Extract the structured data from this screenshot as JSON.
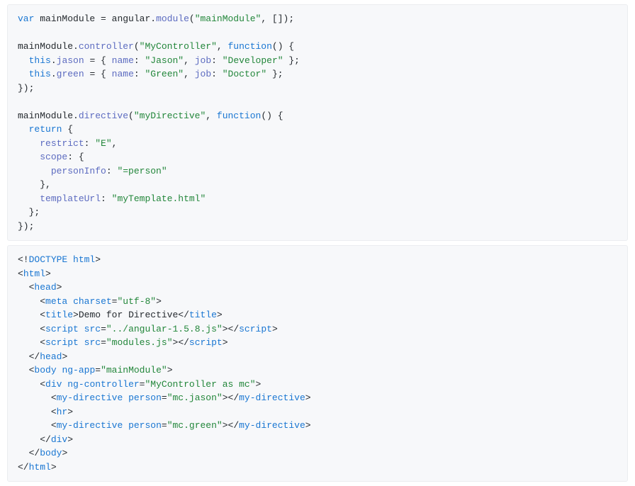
{
  "js": {
    "l1": {
      "kw": "var",
      "id": "mainModule",
      "eq": " = ",
      "obj": "angular",
      "dot": ".",
      "m": "module",
      "lp": "(",
      "s1": "\"mainModule\"",
      "c": ", []);"
    },
    "l3": {
      "id": "mainModule",
      "dot": ".",
      "m": "controller",
      "lp": "(",
      "s1": "\"MyController\"",
      "c1": ", ",
      "kw": "function",
      "paren": "() {"
    },
    "l4": {
      "kw": "this",
      "dot": ".",
      "p": "jason",
      "eq": " = { ",
      "k1": "name",
      "c1": ": ",
      "v1": "\"Jason\"",
      "c2": ", ",
      "k2": "job",
      "c3": ": ",
      "v2": "\"Developer\"",
      "end": " };"
    },
    "l5": {
      "kw": "this",
      "dot": ".",
      "p": "green",
      "eq": " = { ",
      "k1": "name",
      "c1": ": ",
      "v1": "\"Green\"",
      "c2": ", ",
      "k2": "job",
      "c3": ": ",
      "v2": "\"Doctor\"",
      "end": " };"
    },
    "l6": "});",
    "l8": {
      "id": "mainModule",
      "dot": ".",
      "m": "directive",
      "lp": "(",
      "s1": "\"myDirective\"",
      "c1": ", ",
      "kw": "function",
      "paren": "() {"
    },
    "l9": {
      "kw": "return",
      "b": " {"
    },
    "l10": {
      "k": "restrict",
      "c": ": ",
      "v": "\"E\"",
      "end": ","
    },
    "l11": {
      "k": "scope",
      "c": ": {"
    },
    "l12": {
      "k": "personInfo",
      "c": ": ",
      "v": "\"=person\""
    },
    "l13": "    },",
    "l14": {
      "k": "templateUrl",
      "c": ": ",
      "v": "\"myTemplate.html\""
    },
    "l15": "  };",
    "l16": "});"
  },
  "html": {
    "l1": {
      "a": "<!",
      "t": "DOCTYPE html",
      "z": ">"
    },
    "l2": {
      "a": "<",
      "t": "html",
      "z": ">"
    },
    "l3": {
      "a": "<",
      "t": "head",
      "z": ">"
    },
    "l4": {
      "a": "<",
      "t": "meta",
      "sp": " ",
      "an": "charset",
      "eq": "=",
      "av": "\"utf-8\"",
      "z": ">"
    },
    "l5": {
      "a": "<",
      "t": "title",
      "z": ">",
      "txt": "Demo for Directive",
      "ca": "</",
      "ct": "title",
      "cz": ">"
    },
    "l6": {
      "a": "<",
      "t": "script",
      "sp": " ",
      "an": "src",
      "eq": "=",
      "av": "\"../angular-1.5.8.js\"",
      "z": ">",
      "ca": "</",
      "ct": "script",
      "cz": ">"
    },
    "l7": {
      "a": "<",
      "t": "script",
      "sp": " ",
      "an": "src",
      "eq": "=",
      "av": "\"modules.js\"",
      "z": ">",
      "ca": "</",
      "ct": "script",
      "cz": ">"
    },
    "l8": {
      "a": "</",
      "t": "head",
      "z": ">"
    },
    "l9": {
      "a": "<",
      "t": "body",
      "sp": " ",
      "an": "ng-app",
      "eq": "=",
      "av": "\"mainModule\"",
      "z": ">"
    },
    "l10": {
      "a": "<",
      "t": "div",
      "sp": " ",
      "an": "ng-controller",
      "eq": "=",
      "av": "\"MyController as mc\"",
      "z": ">"
    },
    "l11": {
      "a": "<",
      "t": "my-directive",
      "sp": " ",
      "an": "person",
      "eq": "=",
      "av": "\"mc.jason\"",
      "z": ">",
      "ca": "</",
      "ct": "my-directive",
      "cz": ">"
    },
    "l12": {
      "a": "<",
      "t": "hr",
      "z": ">"
    },
    "l13": {
      "a": "<",
      "t": "my-directive",
      "sp": " ",
      "an": "person",
      "eq": "=",
      "av": "\"mc.green\"",
      "z": ">",
      "ca": "</",
      "ct": "my-directive",
      "cz": ">"
    },
    "l14": {
      "a": "</",
      "t": "div",
      "z": ">"
    },
    "l15": {
      "a": "</",
      "t": "body",
      "z": ">"
    },
    "l16": {
      "a": "</",
      "t": "html",
      "z": ">"
    }
  }
}
